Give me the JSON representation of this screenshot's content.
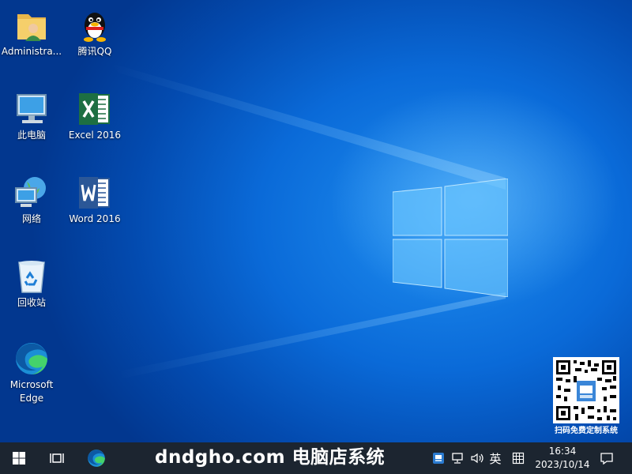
{
  "desktop": {
    "icons": [
      {
        "label": "Administra...",
        "icon": "user-folder-icon"
      },
      {
        "label": "腾讯QQ",
        "icon": "qq-penguin-icon"
      },
      {
        "label": "此电脑",
        "icon": "computer-icon"
      },
      {
        "label": "Excel 2016",
        "icon": "excel-icon"
      },
      {
        "label": "网络",
        "icon": "network-globe-icon"
      },
      {
        "label": "Word 2016",
        "icon": "word-icon"
      },
      {
        "label": "回收站",
        "icon": "recycle-bin-icon"
      },
      {
        "label": "Microsoft Edge",
        "icon": "edge-icon"
      }
    ],
    "qr_caption": "扫码免费定制系统"
  },
  "taskbar": {
    "banner": "dndgho.com 电脑店系统",
    "ime_label": "英",
    "clock_time": "16:34",
    "clock_date": "2023/10/14"
  },
  "colors": {
    "wallpaper": "#0a6ad8",
    "taskbar": "#1c2530",
    "excel": "#1d6f42",
    "word": "#2b5797"
  }
}
